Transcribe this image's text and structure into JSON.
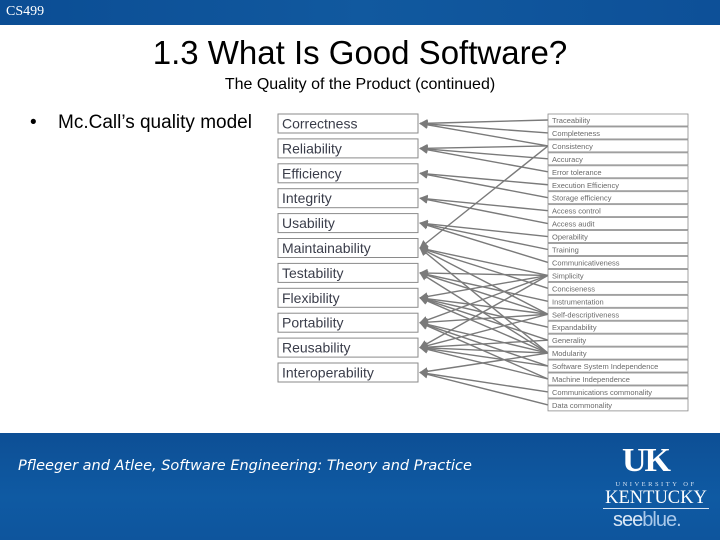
{
  "header": {
    "course": "CS499"
  },
  "title": "1.3 What Is Good Software?",
  "subtitle": "The Quality of the Product (continued)",
  "bullet": {
    "marker": "•",
    "text": "Mc.Call’s quality model"
  },
  "diagram": {
    "factors": [
      "Correctness",
      "Reliability",
      "Efficiency",
      "Integrity",
      "Usability",
      "Maintainability",
      "Testability",
      "Flexibility",
      "Portability",
      "Reusability",
      "Interoperability"
    ],
    "criteria": [
      "Traceability",
      "Completeness",
      "Consistency",
      "Accuracy",
      "Error tolerance",
      "Execution Efficiency",
      "Storage efficiency",
      "Access control",
      "Access audit",
      "Operability",
      "Training",
      "Communicativeness",
      "Simplicity",
      "Conciseness",
      "Instrumentation",
      "Self-descriptiveness",
      "Expandability",
      "Generality",
      "Modularity",
      "Software System Independence",
      "Machine Independence",
      "Communications commonality",
      "Data commonality"
    ],
    "links": [
      [
        "Correctness",
        "Traceability"
      ],
      [
        "Correctness",
        "Completeness"
      ],
      [
        "Correctness",
        "Consistency"
      ],
      [
        "Reliability",
        "Consistency"
      ],
      [
        "Reliability",
        "Accuracy"
      ],
      [
        "Reliability",
        "Error tolerance"
      ],
      [
        "Efficiency",
        "Execution Efficiency"
      ],
      [
        "Efficiency",
        "Storage efficiency"
      ],
      [
        "Integrity",
        "Access control"
      ],
      [
        "Integrity",
        "Access audit"
      ],
      [
        "Usability",
        "Operability"
      ],
      [
        "Usability",
        "Training"
      ],
      [
        "Usability",
        "Communicativeness"
      ],
      [
        "Maintainability",
        "Consistency"
      ],
      [
        "Maintainability",
        "Simplicity"
      ],
      [
        "Maintainability",
        "Conciseness"
      ],
      [
        "Maintainability",
        "Self-descriptiveness"
      ],
      [
        "Maintainability",
        "Modularity"
      ],
      [
        "Testability",
        "Simplicity"
      ],
      [
        "Testability",
        "Instrumentation"
      ],
      [
        "Testability",
        "Self-descriptiveness"
      ],
      [
        "Testability",
        "Modularity"
      ],
      [
        "Flexibility",
        "Simplicity"
      ],
      [
        "Flexibility",
        "Self-descriptiveness"
      ],
      [
        "Flexibility",
        "Expandability"
      ],
      [
        "Flexibility",
        "Generality"
      ],
      [
        "Flexibility",
        "Modularity"
      ],
      [
        "Portability",
        "Simplicity"
      ],
      [
        "Portability",
        "Self-descriptiveness"
      ],
      [
        "Portability",
        "Modularity"
      ],
      [
        "Portability",
        "Software System Independence"
      ],
      [
        "Portability",
        "Machine Independence"
      ],
      [
        "Reusability",
        "Simplicity"
      ],
      [
        "Reusability",
        "Self-descriptiveness"
      ],
      [
        "Reusability",
        "Generality"
      ],
      [
        "Reusability",
        "Modularity"
      ],
      [
        "Reusability",
        "Software System Independence"
      ],
      [
        "Reusability",
        "Machine Independence"
      ],
      [
        "Interoperability",
        "Modularity"
      ],
      [
        "Interoperability",
        "Communications commonality"
      ],
      [
        "Interoperability",
        "Data commonality"
      ]
    ]
  },
  "footer": {
    "citation": "Pfleeger and Atlee, Software Engineering: Theory and Practice",
    "logo_uk": "UK",
    "logo_university": "UNIVERSITY OF",
    "logo_kentucky": "KENTUCKY",
    "logo_see": "see",
    "logo_blue": "blue."
  },
  "colors": {
    "brand_blue": "#0d5098",
    "line_gray": "#7a7a7a",
    "box_border": "#8a8a8a"
  }
}
